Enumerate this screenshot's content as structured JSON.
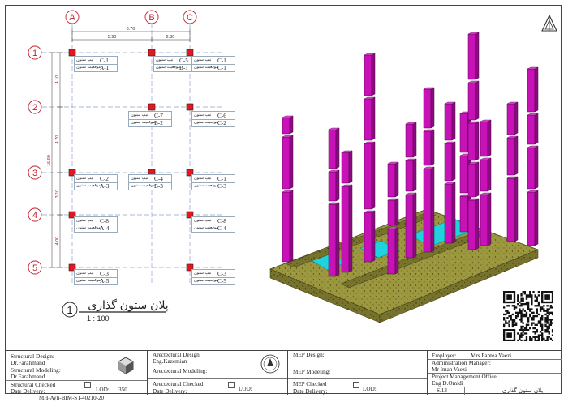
{
  "grid": {
    "columns": [
      "A",
      "B",
      "C"
    ],
    "rows": [
      "1",
      "2",
      "3",
      "4",
      "5"
    ],
    "dims_top": {
      "total": "8.70",
      "ab": "5.90",
      "bc": "2.80"
    },
    "dims_side": {
      "total": "15.90",
      "r12": "4.10",
      "r23": "4.70",
      "r34": "3.10",
      "r45": "4.00"
    }
  },
  "column_tags": [
    {
      "type_label": "تیپ ستون",
      "type": "C-1",
      "pos_label": "موقعیت ستون",
      "pos": "A-1"
    },
    {
      "type_label": "تیپ ستون",
      "type": "C-5",
      "pos_label": "موقعیت ستون",
      "pos": "B-1"
    },
    {
      "type_label": "تیپ ستون",
      "type": "C-1",
      "pos_label": "موقعیت ستون",
      "pos": "C-1"
    },
    {
      "type_label": "تیپ ستون",
      "type": "C-7",
      "pos_label": "موقعیت ستون",
      "pos": "B-2"
    },
    {
      "type_label": "تیپ ستون",
      "type": "C-6",
      "pos_label": "موقعیت ستون",
      "pos": "C-2"
    },
    {
      "type_label": "تیپ ستون",
      "type": "C-2",
      "pos_label": "موقعیت ستون",
      "pos": "A-3"
    },
    {
      "type_label": "تیپ ستون",
      "type": "C-4",
      "pos_label": "موقعیت ستون",
      "pos": "B-3"
    },
    {
      "type_label": "تیپ ستون",
      "type": "C-1",
      "pos_label": "موقعیت ستون",
      "pos": "C-3"
    },
    {
      "type_label": "تیپ ستون",
      "type": "C-8",
      "pos_label": "موقعیت ستون",
      "pos": "A-4"
    },
    {
      "type_label": "تیپ ستون",
      "type": "C-8",
      "pos_label": "موقعیت ستون",
      "pos": "C-4"
    },
    {
      "type_label": "تیپ ستون",
      "type": "C-3",
      "pos_label": "موقعیت ستون",
      "pos": "A-5"
    },
    {
      "type_label": "تیپ ستون",
      "type": "C-3",
      "pos_label": "موقعیت ستون",
      "pos": "C-5"
    }
  ],
  "view_title": {
    "number": "1",
    "name": "پلان ستون گذاری",
    "scale": "1 : 100"
  },
  "title_block": {
    "structural_design_label": "Structural Design:",
    "structural_design": "Dr.Farahmand",
    "structural_modeling_label": "Structural Modeling:",
    "structural_modeling": "Dr.Farahmand",
    "structural_checked": "Structural Checked",
    "date_delivery": "Date Delivery:",
    "lod_label": "LOD:",
    "lod_value": "350",
    "arch_design_label": "Arectectural Design:",
    "arch_design": "Eng.Kazemian",
    "arch_modeling_label": "Arectectural Modeling:",
    "arch_checked": "Arectectural Checked",
    "mep_design_label": "MEP Design:",
    "mep_modeling_label": "MEP Modeling:",
    "mep_checked": "MEP Checked",
    "employer_label": "Employer:",
    "employer": "Mrs.Pantea Vaezi",
    "admin_label": "Administration Manager:",
    "admin": "Mr Iman Vaezi",
    "pmo_label": "Project Management Office:",
    "pmo": "Eng D.Omidi",
    "sheet_no": "S.13",
    "sheet_name": "پلان ستون گذاری",
    "file_code": "MH-Ayli-BIM-ST-40210-20"
  }
}
